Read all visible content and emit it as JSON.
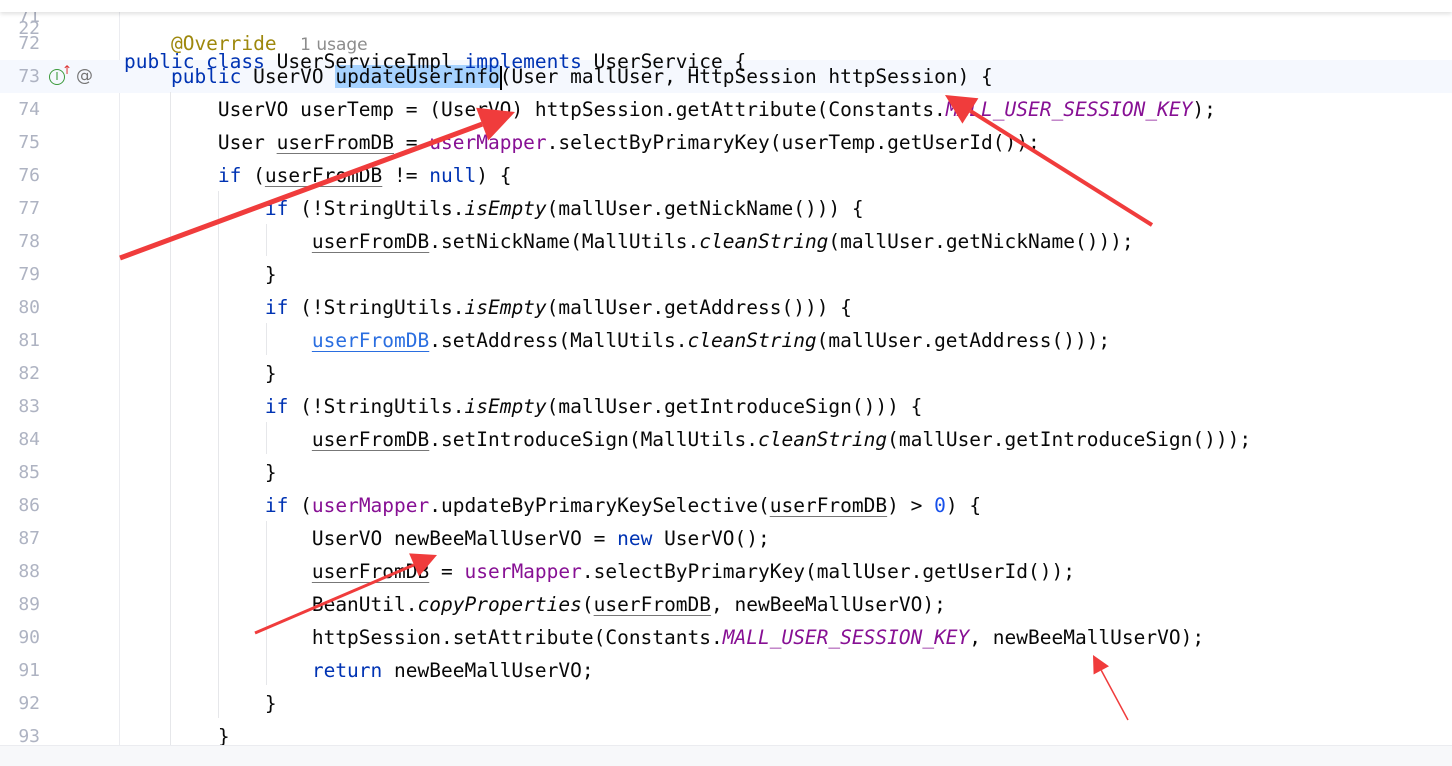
{
  "sticky": {
    "line_number": "22",
    "tokens": [
      [
        "public class ",
        "kw"
      ],
      [
        "UserServiceImpl ",
        ""
      ],
      [
        "implements ",
        "kw"
      ],
      [
        "UserService {",
        ""
      ]
    ]
  },
  "first_line_number": "71",
  "usage_hint": "1 usage",
  "arrow_color": "#f03c3c",
  "lines": [
    {
      "n": "72",
      "tokens": [
        [
          "    @Override",
          "ann"
        ]
      ],
      "hint": true
    },
    {
      "n": "73",
      "current": true,
      "tokens": [
        [
          "    public ",
          "kw"
        ],
        [
          "UserVO ",
          ""
        ],
        [
          "updateUserInfo",
          "sel"
        ],
        [
          "|caret",
          "caret"
        ],
        [
          "(User mallUser, HttpSession httpSession) {",
          ""
        ]
      ]
    },
    {
      "n": "74",
      "tokens": [
        [
          "        UserVO userTemp = (UserVO) httpSession.getAttribute(Constants.",
          ""
        ],
        [
          "MALL_USER_SESSION_KEY",
          "sfld"
        ],
        [
          ");",
          ""
        ]
      ]
    },
    {
      "n": "75",
      "tokens": [
        [
          "        User ",
          ""
        ],
        [
          "userFromDB",
          "ul"
        ],
        [
          " = ",
          ""
        ],
        [
          "userMapper",
          "fld"
        ],
        [
          ".selectByPrimaryKey(userTemp.getUserId());",
          ""
        ]
      ]
    },
    {
      "n": "76",
      "tokens": [
        [
          "        if ",
          "kw"
        ],
        [
          "(",
          ""
        ],
        [
          "userFromDB",
          "ul"
        ],
        [
          " != ",
          ""
        ],
        [
          "null",
          "kw"
        ],
        [
          ") {",
          ""
        ]
      ]
    },
    {
      "n": "77",
      "tokens": [
        [
          "            if ",
          "kw"
        ],
        [
          "(!StringUtils.",
          ""
        ],
        [
          "isEmpty",
          "it"
        ],
        [
          "(mallUser.getNickName())) {",
          ""
        ]
      ]
    },
    {
      "n": "78",
      "tokens": [
        [
          "                ",
          ""
        ],
        [
          "userFromDB",
          "ul"
        ],
        [
          ".setNickName(MallUtils.",
          ""
        ],
        [
          "cleanString",
          "it"
        ],
        [
          "(mallUser.getNickName()));",
          ""
        ]
      ]
    },
    {
      "n": "79",
      "tokens": [
        [
          "            }",
          ""
        ]
      ]
    },
    {
      "n": "80",
      "tokens": [
        [
          "            if ",
          "kw"
        ],
        [
          "(!StringUtils.",
          ""
        ],
        [
          "isEmpty",
          "it"
        ],
        [
          "(mallUser.getAddress())) {",
          ""
        ]
      ]
    },
    {
      "n": "81",
      "tokens": [
        [
          "                ",
          ""
        ],
        [
          "userFromDB",
          "link"
        ],
        [
          ".setAddress(MallUtils.",
          ""
        ],
        [
          "cleanString",
          "it"
        ],
        [
          "(mallUser.getAddress()));",
          ""
        ]
      ]
    },
    {
      "n": "82",
      "tokens": [
        [
          "            }",
          ""
        ]
      ]
    },
    {
      "n": "83",
      "tokens": [
        [
          "            if ",
          "kw"
        ],
        [
          "(!StringUtils.",
          ""
        ],
        [
          "isEmpty",
          "it"
        ],
        [
          "(mallUser.getIntroduceSign())) {",
          ""
        ]
      ]
    },
    {
      "n": "84",
      "tokens": [
        [
          "                ",
          ""
        ],
        [
          "userFromDB",
          "ul"
        ],
        [
          ".setIntroduceSign(MallUtils.",
          ""
        ],
        [
          "cleanString",
          "it"
        ],
        [
          "(mallUser.getIntroduceSign()));",
          ""
        ]
      ]
    },
    {
      "n": "85",
      "tokens": [
        [
          "            }",
          ""
        ]
      ]
    },
    {
      "n": "86",
      "tokens": [
        [
          "            if ",
          "kw"
        ],
        [
          "(",
          ""
        ],
        [
          "userMapper",
          "fld"
        ],
        [
          ".updateByPrimaryKeySelective(",
          ""
        ],
        [
          "userFromDB",
          "ul"
        ],
        [
          ") > ",
          ""
        ],
        [
          "0",
          "num"
        ],
        [
          ") {",
          ""
        ]
      ]
    },
    {
      "n": "87",
      "tokens": [
        [
          "                UserVO newBeeMallUserVO = ",
          ""
        ],
        [
          "new ",
          "kw"
        ],
        [
          "UserVO();",
          ""
        ]
      ]
    },
    {
      "n": "88",
      "tokens": [
        [
          "                ",
          ""
        ],
        [
          "userFromDB",
          "ul"
        ],
        [
          " = ",
          ""
        ],
        [
          "userMapper",
          "fld"
        ],
        [
          ".selectByPrimaryKey(mallUser.getUserId());",
          ""
        ]
      ]
    },
    {
      "n": "89",
      "tokens": [
        [
          "                BeanUtil.",
          ""
        ],
        [
          "copyProperties",
          "it"
        ],
        [
          "(",
          ""
        ],
        [
          "userFromDB",
          "ul"
        ],
        [
          ", newBeeMallUserVO);",
          ""
        ]
      ]
    },
    {
      "n": "90",
      "tokens": [
        [
          "                httpSession.setAttribute(Constants.",
          ""
        ],
        [
          "MALL_USER_SESSION_KEY",
          "sfld"
        ],
        [
          ", newBeeMallUserVO);",
          ""
        ]
      ]
    },
    {
      "n": "91",
      "tokens": [
        [
          "                return ",
          "kw"
        ],
        [
          "newBeeMallUserVO;",
          ""
        ]
      ]
    },
    {
      "n": "92",
      "tokens": [
        [
          "            }",
          ""
        ]
      ]
    },
    {
      "n": "93",
      "tokens": [
        [
          "        }",
          ""
        ]
      ]
    }
  ],
  "gutter_icons": [
    "implements-method-icon",
    "override-arrow-icon",
    "annotation-at-icon"
  ]
}
